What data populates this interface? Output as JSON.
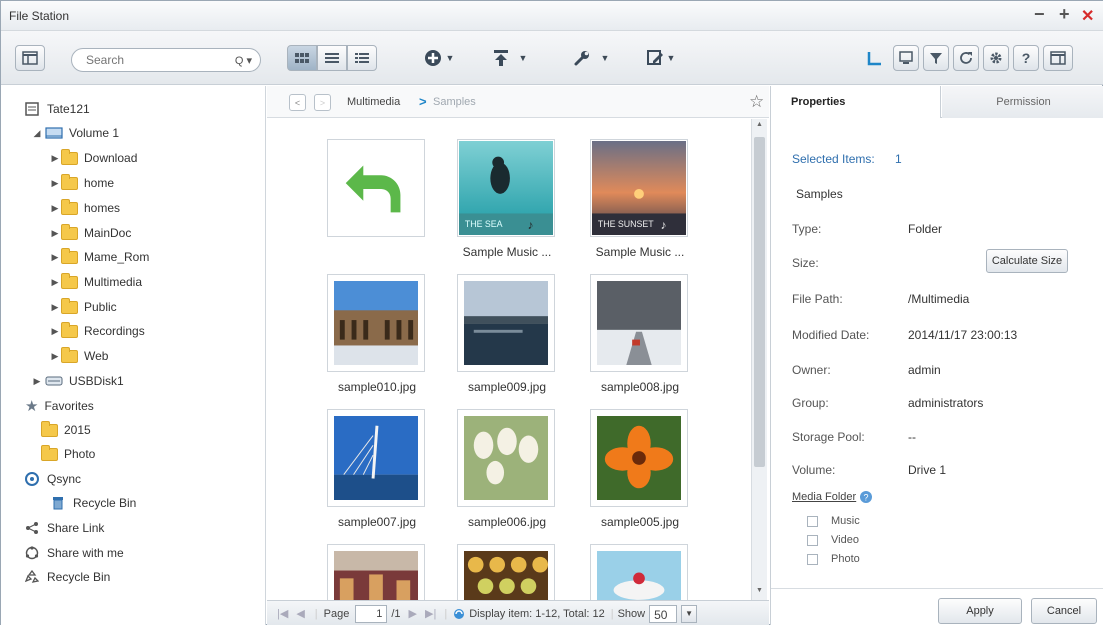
{
  "window": {
    "title": "File Station",
    "minimize": "−",
    "maximize": "+",
    "close": "✕"
  },
  "toolbar": {
    "search_placeholder": "Search",
    "search_dropdown": "Q ▾"
  },
  "sidebar": {
    "root": "Tate121",
    "volume": "Volume 1",
    "folders": [
      "Download",
      "home",
      "homes",
      "MainDoc",
      "Mame_Rom",
      "Multimedia",
      "Public",
      "Recordings",
      "Web"
    ],
    "usb": "USBDisk1",
    "favorites": "Favorites",
    "fav_items": [
      "2015",
      "Photo"
    ],
    "qsync": "Qsync",
    "qsync_recycle": "Recycle Bin",
    "share_link": "Share Link",
    "share_with_me": "Share with me",
    "recycle_bin": "Recycle Bin"
  },
  "breadcrumb": {
    "parent": "Multimedia",
    "sep": ">",
    "current": "Samples"
  },
  "files": [
    {
      "name": "",
      "kind": "up"
    },
    {
      "name": "Sample Music ...",
      "kind": "music1",
      "band": "THE SEA"
    },
    {
      "name": "Sample Music ...",
      "kind": "music2",
      "band": "THE SUNSET"
    },
    {
      "name": "sample010.jpg",
      "kind": "palace"
    },
    {
      "name": "sample009.jpg",
      "kind": "lake"
    },
    {
      "name": "sample008.jpg",
      "kind": "snow"
    },
    {
      "name": "sample007.jpg",
      "kind": "bridge"
    },
    {
      "name": "sample006.jpg",
      "kind": "tulips"
    },
    {
      "name": "sample005.jpg",
      "kind": "flower"
    },
    {
      "name": "",
      "kind": "market"
    },
    {
      "name": "",
      "kind": "macarons"
    },
    {
      "name": "",
      "kind": "cake"
    }
  ],
  "pager": {
    "page_label": "Page",
    "page_value": "1",
    "page_total": "/1",
    "display": "Display item: 1-12, Total: 12",
    "show_label": "Show",
    "show_value": "50"
  },
  "properties": {
    "tab_properties": "Properties",
    "tab_permission": "Permission",
    "selected_label": "Selected Items:",
    "selected_value": "1",
    "name": "Samples",
    "type_label": "Type:",
    "type_value": "Folder",
    "size_label": "Size:",
    "calc_button": "Calculate Size",
    "path_label": "File Path:",
    "path_value": "/Multimedia",
    "modified_label": "Modified Date:",
    "modified_value": "2014/11/17 23:00:13",
    "owner_label": "Owner:",
    "owner_value": "admin",
    "group_label": "Group:",
    "group_value": "administrators",
    "pool_label": "Storage Pool:",
    "pool_value": "--",
    "volume_label": "Volume:",
    "volume_value": "Drive 1",
    "media_folder": "Media Folder",
    "media_options": [
      "Music",
      "Video",
      "Photo"
    ],
    "apply": "Apply",
    "cancel": "Cancel"
  }
}
